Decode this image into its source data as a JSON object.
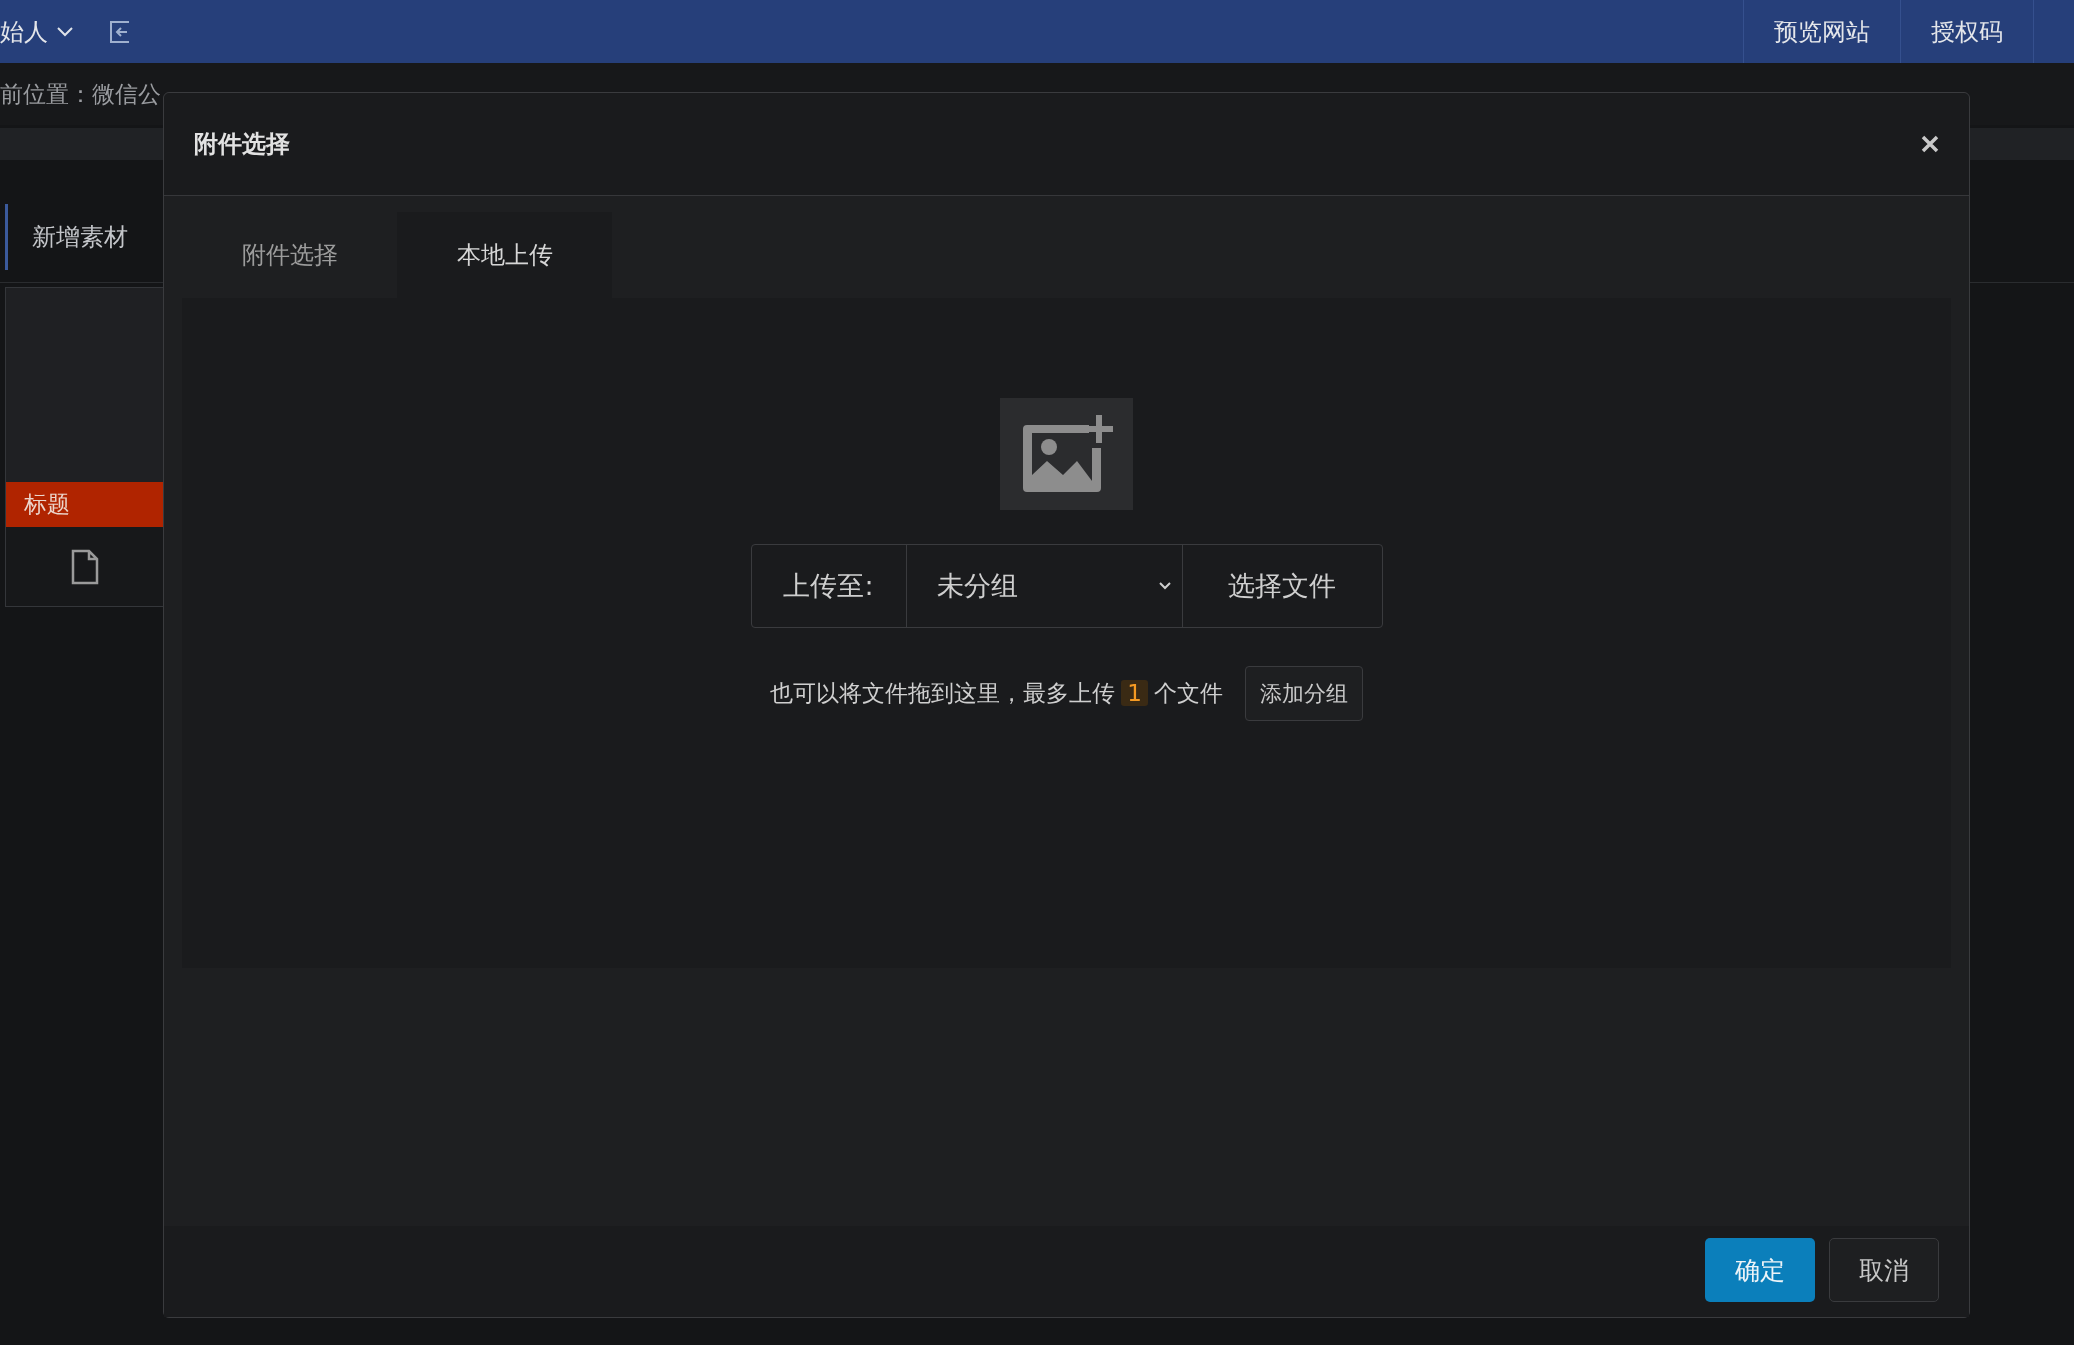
{
  "top_bar": {
    "user": "始人",
    "nav": [
      "预览网站",
      "授权码"
    ]
  },
  "breadcrumb": "前位置：微信公",
  "page": {
    "tab": "新增素材",
    "card_title": "标题"
  },
  "dialog": {
    "title": "附件选择",
    "tabs": [
      {
        "label": "附件选择",
        "selected": false
      },
      {
        "label": "本地上传",
        "selected": true
      }
    ],
    "upload": {
      "label": "上传至:",
      "group": "未分组",
      "choose_button": "选择文件",
      "hint_before": "也可以将文件拖到这里，最多上传",
      "max_count": "1",
      "hint_after": "个文件",
      "add_group_button": "添加分组"
    },
    "buttons": [
      {
        "label": "确定",
        "kind": "primary"
      },
      {
        "label": "取消",
        "kind": "secondary"
      }
    ]
  }
}
